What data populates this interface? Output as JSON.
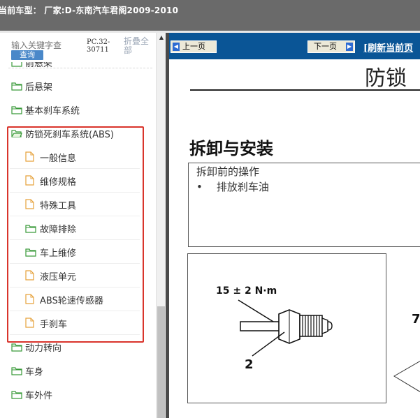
{
  "window": {
    "title": "当前车型：  厂家:D-东南汽车君阁2009-2010"
  },
  "left_pane": {
    "search_placeholder": "输入关键字查",
    "search_button": "查询",
    "part_code": "PC.32-30711",
    "fold_all": "折叠全部",
    "tree": [
      {
        "label": "前悬架",
        "type": "folder",
        "level": 0
      },
      {
        "label": "后悬架",
        "type": "folder",
        "level": 0
      },
      {
        "label": "基本刹车系统",
        "type": "folder",
        "level": 0
      },
      {
        "label": "防锁死刹车系统(ABS)",
        "type": "folder-open",
        "level": 0
      },
      {
        "label": "一般信息",
        "type": "page",
        "level": 1
      },
      {
        "label": "维修规格",
        "type": "page",
        "level": 1
      },
      {
        "label": "特殊工具",
        "type": "page",
        "level": 1
      },
      {
        "label": "故障排除",
        "type": "folder",
        "level": 1
      },
      {
        "label": "车上维修",
        "type": "folder",
        "level": 1
      },
      {
        "label": "液压单元",
        "type": "page",
        "level": 1
      },
      {
        "label": "ABS轮速传感器",
        "type": "page",
        "level": 1
      },
      {
        "label": "手刹车",
        "type": "page",
        "level": 1
      },
      {
        "label": "动力转向",
        "type": "folder",
        "level": 0
      },
      {
        "label": "车身",
        "type": "folder",
        "level": 0
      },
      {
        "label": "车外件",
        "type": "folder",
        "level": 0
      }
    ],
    "highlight_color": "#d9342b"
  },
  "doc_pane": {
    "prev_button": "上一页",
    "next_button": "下一页",
    "refresh_link": "[刷新当前页",
    "doc_title": "防锁",
    "section_title": "拆卸与安装",
    "pre_ops_title": "拆卸前的操作",
    "pre_ops_bullet": "•",
    "pre_ops_item": "排放刹车油",
    "figure": {
      "torque_label": "15 ± 2 N·m",
      "callout_2": "2",
      "callout_7": "7"
    },
    "nav_color": "#0a5596"
  }
}
